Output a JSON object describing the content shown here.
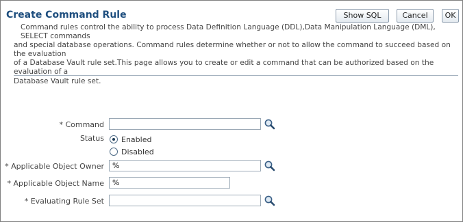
{
  "header": {
    "title": "Create Command Rule",
    "buttons": {
      "show_sql": "Show SQL",
      "cancel": "Cancel",
      "ok": "OK"
    }
  },
  "description": {
    "line1": "Command rules control the ability to process Data Definition Language (DDL),Data Manipulation Language (DML), SELECT commands",
    "line2": "and special database operations. Command rules determine whether or not to allow the command to succeed based on the evaluation",
    "line3": "of a Database Vault rule set.This page allows you to create or edit a command that can be authorized based on the evaluation of a",
    "line4": "Database Vault rule set."
  },
  "form": {
    "required_marker": "*",
    "command": {
      "label": "Command",
      "value": ""
    },
    "status": {
      "label": "Status",
      "options": [
        "Enabled",
        "Disabled"
      ],
      "selected": "Enabled"
    },
    "applicable_object_owner": {
      "label": "Applicable Object Owner",
      "value": "%"
    },
    "applicable_object_name": {
      "label": "Applicable Object Name",
      "value": "%"
    },
    "evaluating_rule_set": {
      "label": "Evaluating Rule Set",
      "value": ""
    }
  },
  "icons": {
    "search": "magnifying-glass"
  }
}
